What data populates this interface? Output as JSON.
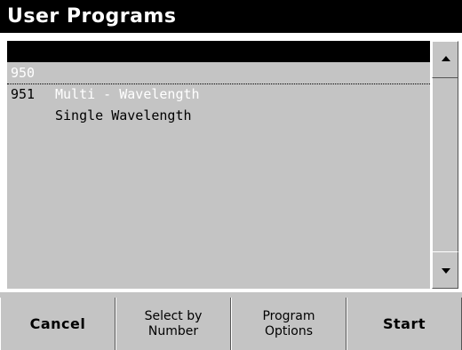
{
  "window": {
    "title": "User Programs"
  },
  "programs": [
    {
      "number": "950",
      "name": "Multi - Wavelength",
      "selected": true
    },
    {
      "number": "951",
      "name": "Single Wavelength",
      "selected": false
    }
  ],
  "scroll": {
    "up_icon": "triangle-up-icon",
    "down_icon": "triangle-down-icon"
  },
  "buttons": {
    "cancel": "Cancel",
    "select_by_number": {
      "line1": "Select by",
      "line2": "Number"
    },
    "program_options": {
      "line1": "Program",
      "line2": "Options"
    },
    "start": "Start"
  },
  "colors": {
    "background": "#c4c4c4",
    "title_bar": "#000000",
    "selection": "#000000"
  }
}
